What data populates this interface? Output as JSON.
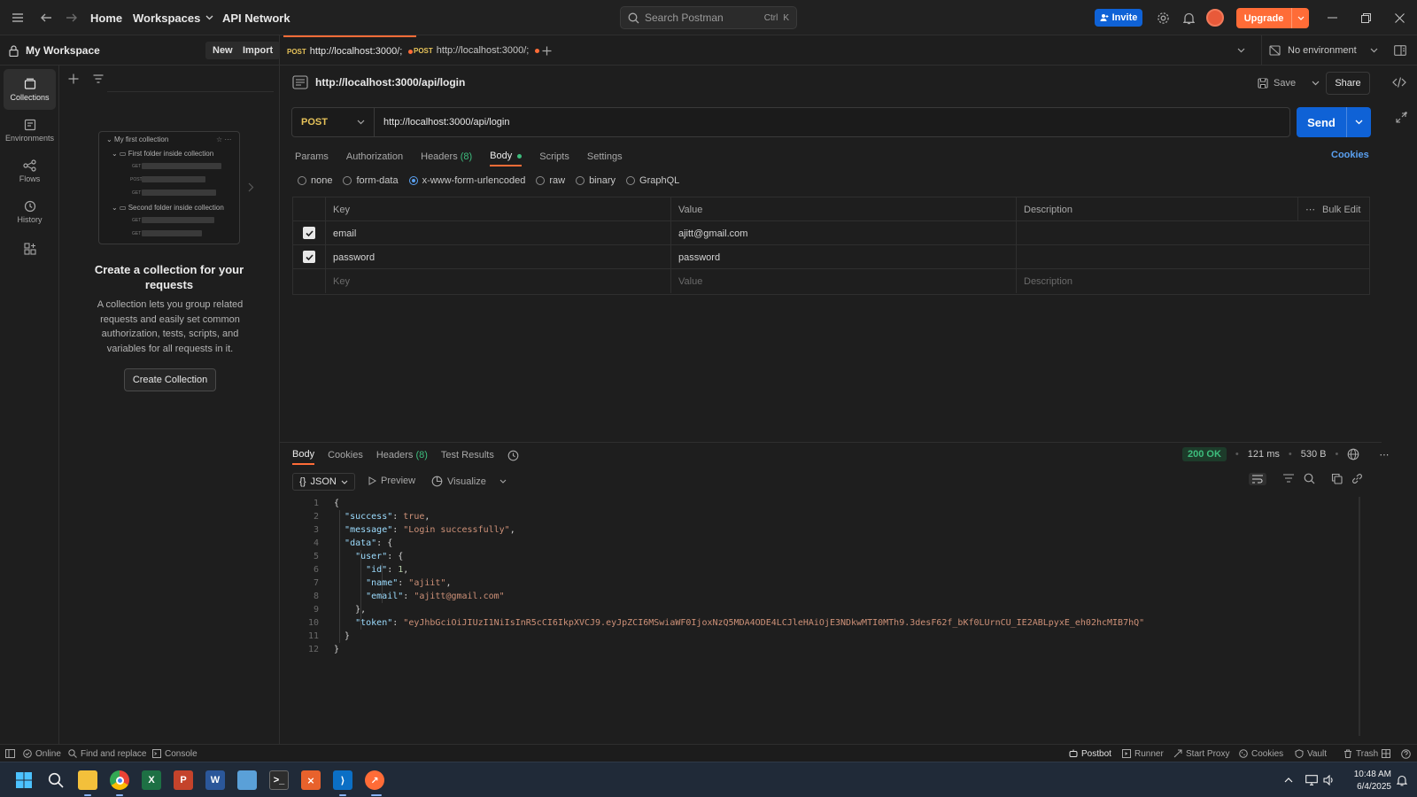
{
  "topbar": {
    "nav": [
      "Home",
      "Workspaces",
      "API Network"
    ],
    "search_placeholder": "Search Postman",
    "search_kbd": [
      "Ctrl",
      "K"
    ],
    "invite_label": "Invite",
    "upgrade_label": "Upgrade"
  },
  "workspace": {
    "name": "My Workspace",
    "new_label": "New",
    "import_label": "Import",
    "tabs": [
      {
        "method": "POST",
        "label": "http://localhost:3000/;"
      },
      {
        "method": "POST",
        "label": "http://localhost:3000/;"
      }
    ],
    "environment": "No environment"
  },
  "rail": {
    "items": [
      "Collections",
      "Environments",
      "Flows",
      "History"
    ]
  },
  "collections_panel": {
    "preview": {
      "collection": "My first collection",
      "folder1": "First folder inside collection",
      "folder2": "Second folder inside collection",
      "methods": [
        "GET",
        "POST",
        "GET",
        "GET",
        "GET"
      ]
    },
    "title": "Create a collection for your requests",
    "description": "A collection lets you group related requests and easily set common authorization, tests, scripts, and variables for all requests in it.",
    "button": "Create Collection"
  },
  "request": {
    "title": "http://localhost:3000/api/login",
    "save_label": "Save",
    "share_label": "Share",
    "method": "POST",
    "url": "http://localhost:3000/api/login",
    "send_label": "Send",
    "tabs": [
      "Params",
      "Authorization",
      "Headers",
      "Body",
      "Scripts",
      "Settings"
    ],
    "headers_count": "(8)",
    "cookies_label": "Cookies",
    "body_modes": [
      "none",
      "form-data",
      "x-www-form-urlencoded",
      "raw",
      "binary",
      "GraphQL"
    ],
    "table": {
      "headers": [
        "Key",
        "Value",
        "Description"
      ],
      "bulk_edit": "Bulk Edit",
      "rows": [
        {
          "key": "email",
          "value": "ajitt@gmail.com"
        },
        {
          "key": "password",
          "value": "password"
        }
      ],
      "placeholders": [
        "Key",
        "Value",
        "Description"
      ]
    }
  },
  "response": {
    "tabs": [
      "Body",
      "Cookies",
      "Headers",
      "Test Results"
    ],
    "headers_count": "(8)",
    "status": "200 OK",
    "time": "121 ms",
    "size": "530 B",
    "format": "JSON",
    "preview_label": "Preview",
    "visualize_label": "Visualize",
    "lines": [
      "{",
      "  \"success\": true,",
      "  \"message\": \"Login successfully\",",
      "  \"data\": {",
      "    \"user\": {",
      "      \"id\": 1,",
      "      \"name\": \"ajiit\",",
      "      \"email\": \"ajitt@gmail.com\"",
      "    },",
      "    \"token\": \"eyJhbGciOiJIUzI1NiIsInR5cCI6IkpXVCJ9.eyJpZCI6MSwiaWF0IjoxNzQ5MDA4ODE4LCJleHAiOjE3NDkwMTI0MTh9.3desF62f_bKf0LUrnCU_IE2ABLpyxE_eh02hcMIB7hQ\"",
      "  }",
      "}"
    ]
  },
  "statusbar": {
    "left": [
      "Online",
      "Find and replace",
      "Console"
    ],
    "right": [
      "Postbot",
      "Runner",
      "Start Proxy",
      "Cookies",
      "Vault",
      "Trash"
    ]
  },
  "taskbar": {
    "time": "10:48 AM",
    "date": "6/4/2025"
  },
  "colors": {
    "accent": "#ff6c37",
    "send_blue": "#0f62d6",
    "status_green": "#3dbd7d"
  }
}
